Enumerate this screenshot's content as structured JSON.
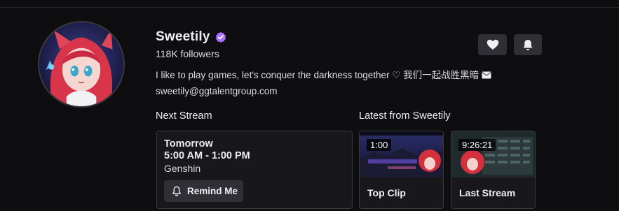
{
  "channel": {
    "name": "Sweetily",
    "followers": "118K followers",
    "bio_line1": "I like to play games, let's conquer the darkness together ♡ 我们一起战胜黑暗",
    "bio_line2": "sweetily@ggtalentgroup.com",
    "verified_color": "#a970ff"
  },
  "actions": {
    "follow_icon": "heart-icon",
    "notify_icon": "bell-icon"
  },
  "next_stream": {
    "section_title": "Next Stream",
    "day": "Tomorrow",
    "time": "5:00 AM - 1:00 PM",
    "game": "Genshin",
    "remind_label": "Remind Me"
  },
  "latest": {
    "section_title": "Latest from Sweetily",
    "items": [
      {
        "duration": "1:00",
        "label": "Top Clip"
      },
      {
        "duration": "9:26:21",
        "label": "Last Stream"
      }
    ]
  }
}
